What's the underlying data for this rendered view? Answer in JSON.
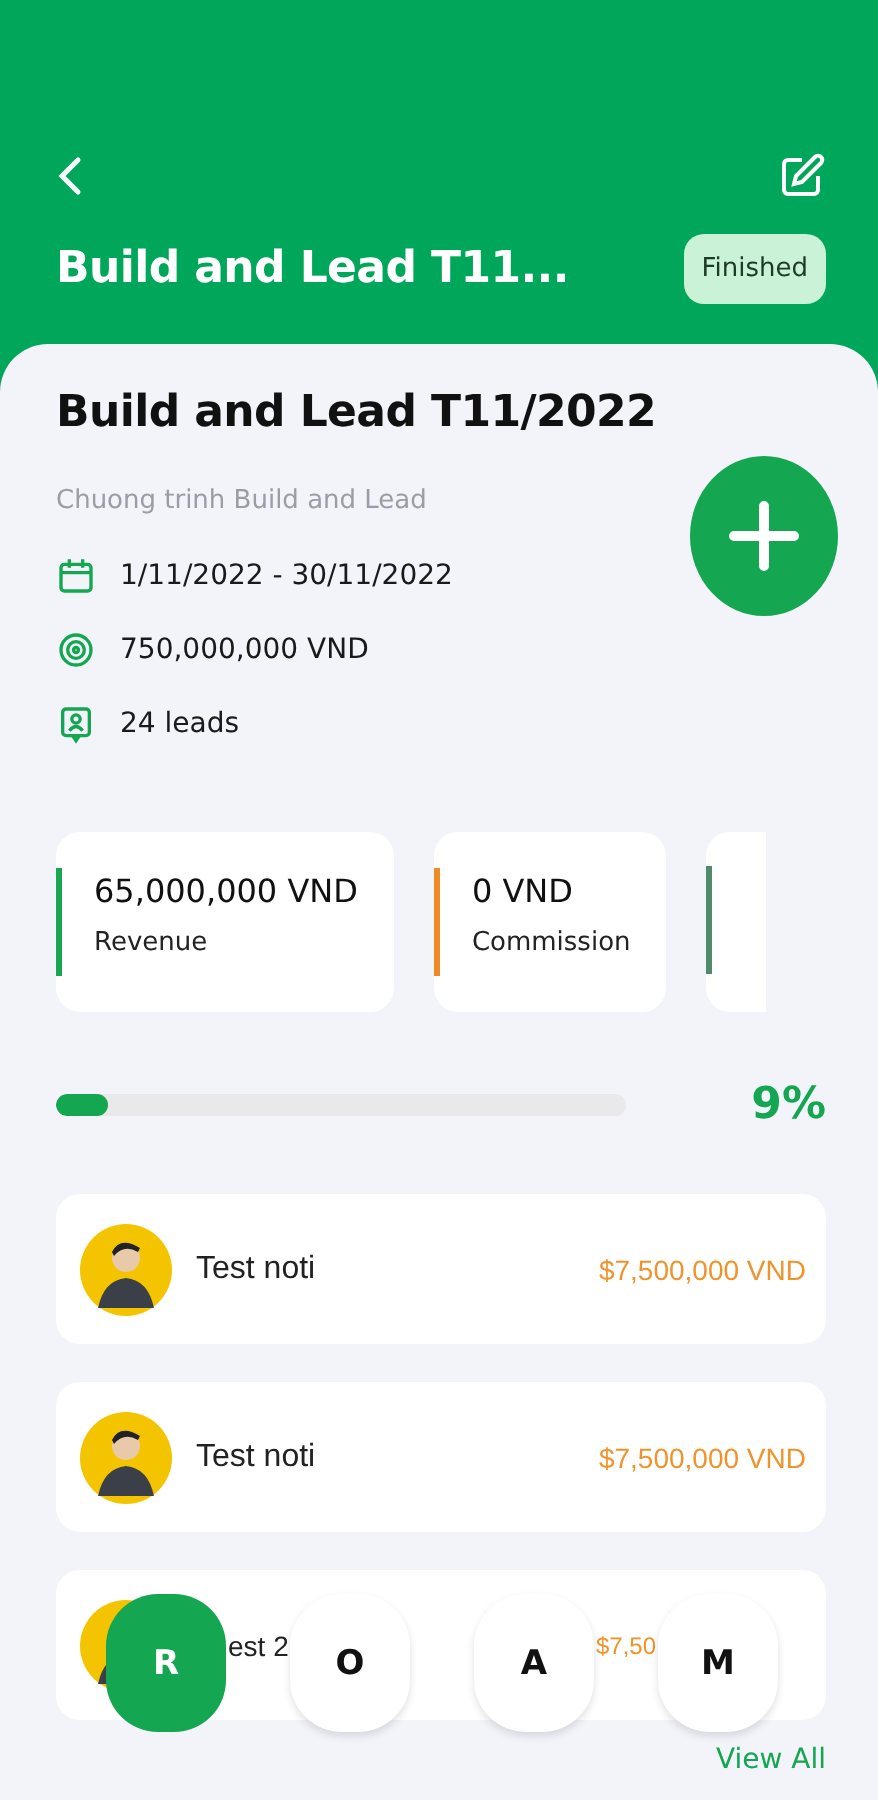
{
  "header": {
    "title": "Build and Lead T11...",
    "status": "Finished"
  },
  "campaign": {
    "title": "Build and Lead T11/2022",
    "subtitle": "Chuong trinh Build and Lead",
    "info": [
      {
        "kind": "date",
        "text": "1/11/2022 - 30/11/2022"
      },
      {
        "kind": "target",
        "text": "750,000,000 VND"
      },
      {
        "kind": "leads",
        "text": "24 leads"
      }
    ]
  },
  "stats": [
    {
      "value": "65,000,000 VND",
      "label": "Revenue",
      "color": "#1aa551"
    },
    {
      "value": "0 VND",
      "label": "Commission",
      "color": "#f08a24"
    }
  ],
  "progress": {
    "level": 0.09,
    "reading": "9%"
  },
  "leads": [
    {
      "name": "Test noti",
      "amount": "$7,500,000 VND"
    },
    {
      "name": "Test noti",
      "amount": "$7,500,000 VND"
    },
    {
      "name": "est 2",
      "amount": "$7,50"
    }
  ],
  "view_all": "View All",
  "nav": [
    {
      "label": "R",
      "selected": true
    },
    {
      "label": "O",
      "selected": false
    },
    {
      "label": "A",
      "selected": false
    },
    {
      "label": "M",
      "selected": false
    }
  ]
}
